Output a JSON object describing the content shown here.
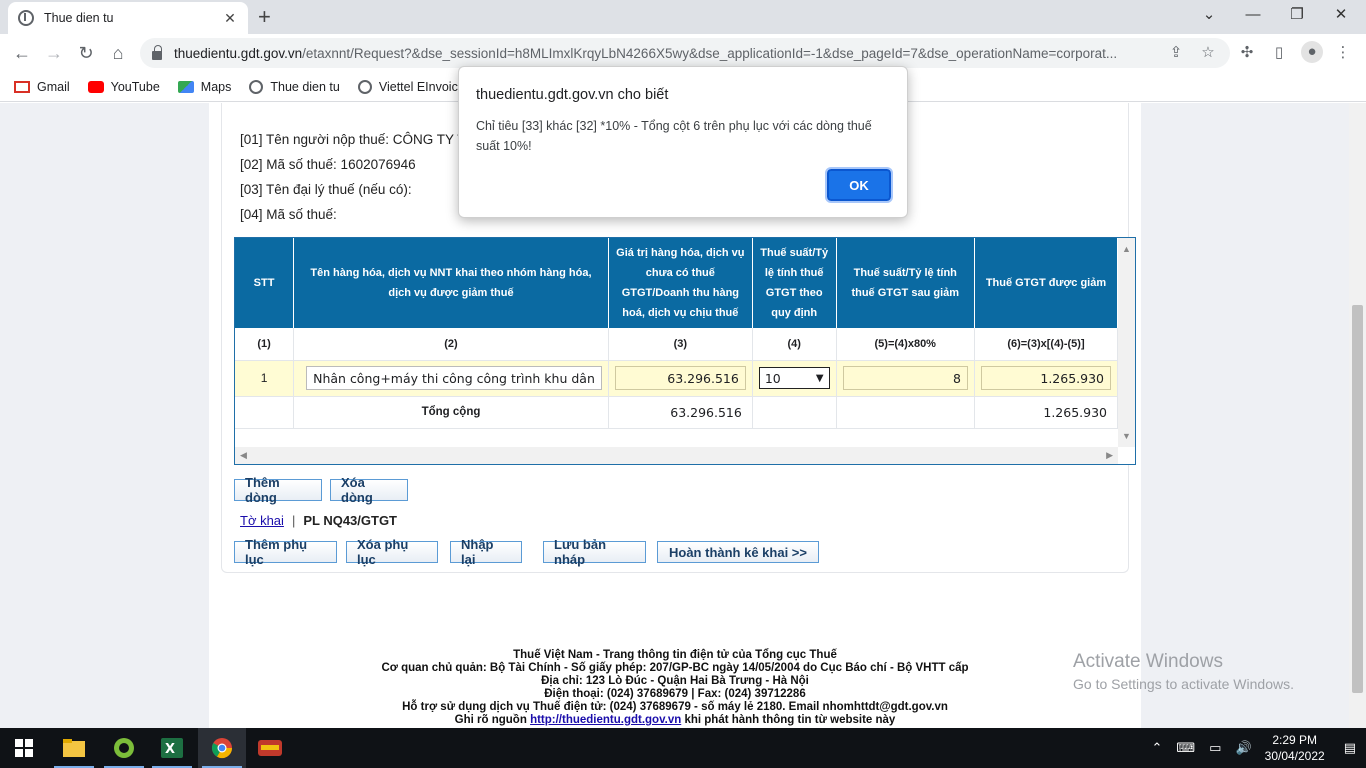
{
  "browser": {
    "tab_title": "Thue dien tu",
    "url_host": "thuedientu.gdt.gov.vn",
    "url_rest": "/etaxnnt/Request?&dse_sessionId=h8MLImxlKrqyLbN4266X5wy&dse_applicationId=-1&dse_pageId=7&dse_operationName=corporat...",
    "bookmarks": [
      "Gmail",
      "YouTube",
      "Maps",
      "Thue dien tu",
      "Viettel EInvoice s"
    ]
  },
  "info": {
    "l01": "[01] Tên người nộp thuế: CÔNG TY TNHH",
    "l02": "[02] Mã số thuế: 1602076946",
    "l03": "[03] Tên đại lý thuế (nếu có):",
    "l04": "[04] Mã số thuế:"
  },
  "table": {
    "headers": {
      "stt": "STT",
      "name": "Tên hàng hóa, dịch vụ NNT khai theo nhóm hàng hóa, dịch vụ được giảm thuế",
      "value": "Giá trị hàng hóa, dịch vụ chưa có thuế GTGT/Doanh thu hàng hoá, dịch vụ chịu thuế",
      "rate": "Thuế suất/Tỷ lệ tính thuế GTGT theo quy định",
      "rate_after": "Thuế suất/Tỷ lệ tính thuế GTGT sau giảm",
      "reduced": "Thuế GTGT được giảm"
    },
    "col_numbers": [
      "(1)",
      "(2)",
      "(3)",
      "(4)",
      "(5)=(4)x80%",
      "(6)=(3)x[(4)-(5)]"
    ],
    "row": {
      "stt": "1",
      "name": "Nhân công+máy thi công công trình khu dân",
      "value": "63.296.516",
      "rate": "10",
      "rate_after": "8",
      "reduced": "1.265.930"
    },
    "total": {
      "label": "Tổng cộng",
      "value": "63.296.516",
      "reduced": "1.265.930"
    }
  },
  "buttons": {
    "add_row": "Thêm dòng",
    "delete_row": "Xóa dòng",
    "add_appendix": "Thêm phụ lục",
    "delete_appendix": "Xóa phụ lục",
    "reenter": "Nhập lại",
    "save_draft": "Lưu bản nháp",
    "finish": "Hoàn thành kê khai >>"
  },
  "form_tabs": {
    "declaration": "Tờ khai",
    "separator": "|",
    "current": "PL NQ43/GTGT"
  },
  "footer": {
    "l1": "Thuế Việt Nam - Trang thông tin điện tử của Tổng cục Thuế",
    "l2": "Cơ quan chủ quản: Bộ Tài Chính - Số giấy phép: 207/GP-BC ngày 14/05/2004 do Cục Báo chí - Bộ VHTT cấp",
    "l3": "Địa chỉ: 123 Lò Đúc - Quận Hai Bà Trưng - Hà Nội",
    "l4": "Điện thoại: (024) 37689679 | Fax: (024) 39712286",
    "l5": "Hỗ trợ sử dụng dịch vụ Thuế điện tử: (024) 37689679 - số máy lẻ 2180. Email nhomhttdt@gdt.gov.vn",
    "l6_pre": "Ghi rõ nguồn",
    "l6_link": "http://thuedientu.gdt.gov.vn",
    "l6_post": "khi phát hành thông tin từ website này"
  },
  "watermark": {
    "title": "Activate Windows",
    "subtitle": "Go to Settings to activate Windows."
  },
  "dialog": {
    "title": "thuedientu.gdt.gov.vn cho biết",
    "message": "Chỉ tiêu [33] khác [32] *10% - Tổng cột 6 trên phụ lục với các dòng thuế suất 10%!",
    "ok": "OK"
  },
  "taskbar": {
    "time": "2:29 PM",
    "date": "30/04/2022"
  },
  "colors": {
    "header_blue": "#0b6aa2",
    "input_yellow": "#fffcd4",
    "dialog_button": "#1a73e8"
  }
}
